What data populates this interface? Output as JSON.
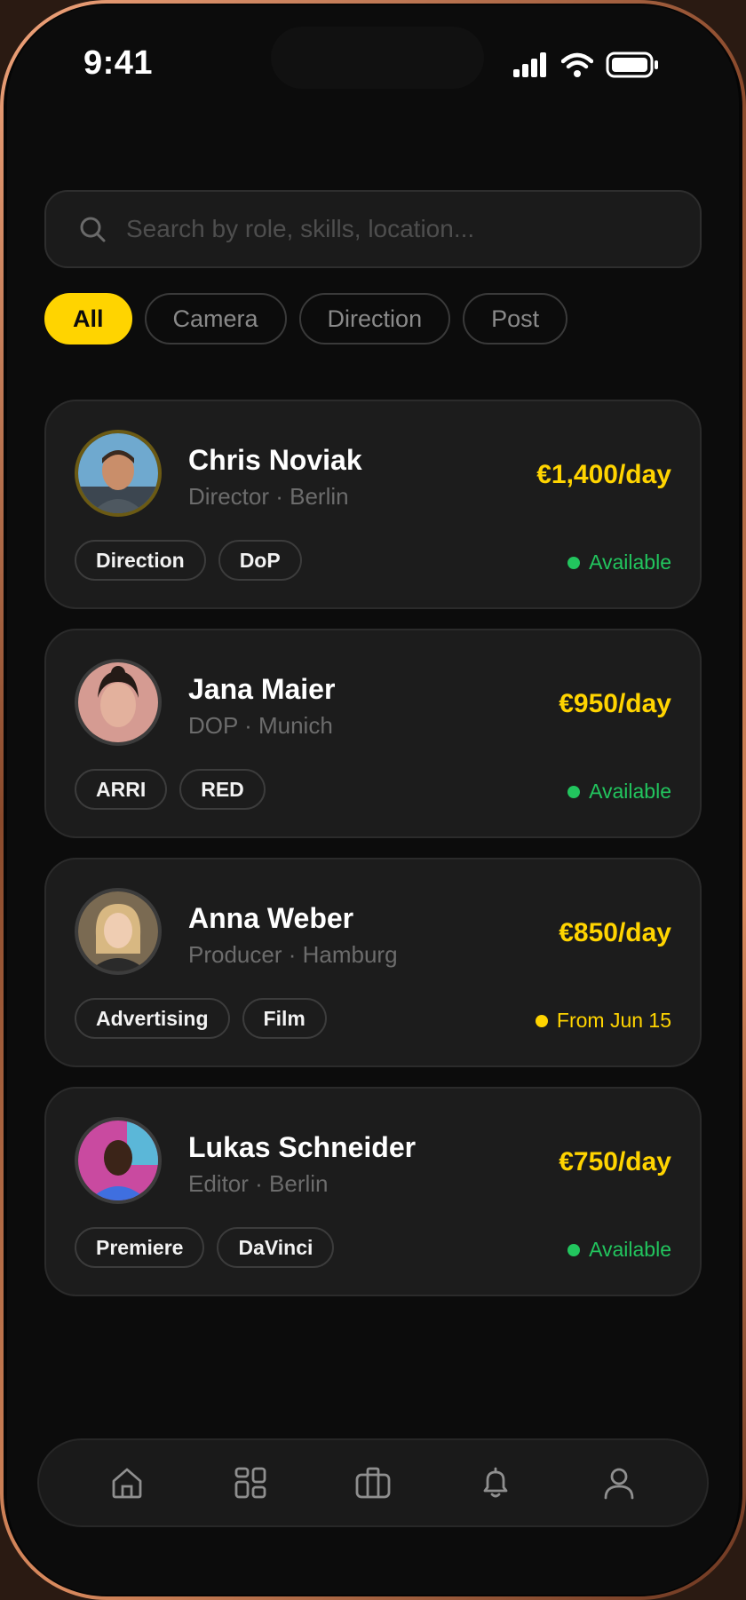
{
  "status_bar": {
    "time": "9:41"
  },
  "search": {
    "placeholder": "Search by role, skills, location..."
  },
  "filters": [
    {
      "label": "All",
      "active": true
    },
    {
      "label": "Camera",
      "active": false
    },
    {
      "label": "Direction",
      "active": false
    },
    {
      "label": "Post",
      "active": false
    }
  ],
  "crew": [
    {
      "name": "Chris Noviak",
      "role": "Director · Berlin",
      "rate": "€1,400/day",
      "tags": [
        "Direction",
        "DoP"
      ],
      "availability": "Available",
      "availability_color": "#22c55e"
    },
    {
      "name": "Jana Maier",
      "role": "DOP · Munich",
      "rate": "€950/day",
      "tags": [
        "ARRI",
        "RED"
      ],
      "availability": "Available",
      "availability_color": "#22c55e"
    },
    {
      "name": "Anna Weber",
      "role": "Producer · Hamburg",
      "rate": "€850/day",
      "tags": [
        "Advertising",
        "Film"
      ],
      "availability": "From Jun 15",
      "availability_color": "#ffd400"
    },
    {
      "name": "Lukas Schneider",
      "role": "Editor · Berlin",
      "rate": "€750/day",
      "tags": [
        "Premiere",
        "DaVinci"
      ],
      "availability": "Available",
      "availability_color": "#22c55e"
    }
  ],
  "nav": [
    {
      "icon": "home-icon"
    },
    {
      "icon": "grid-icon"
    },
    {
      "icon": "briefcase-icon"
    },
    {
      "icon": "bell-icon"
    },
    {
      "icon": "user-icon"
    }
  ],
  "colors": {
    "accent": "#ffd400",
    "available": "#22c55e",
    "background": "#0c0c0c",
    "card": "#1c1c1c"
  }
}
